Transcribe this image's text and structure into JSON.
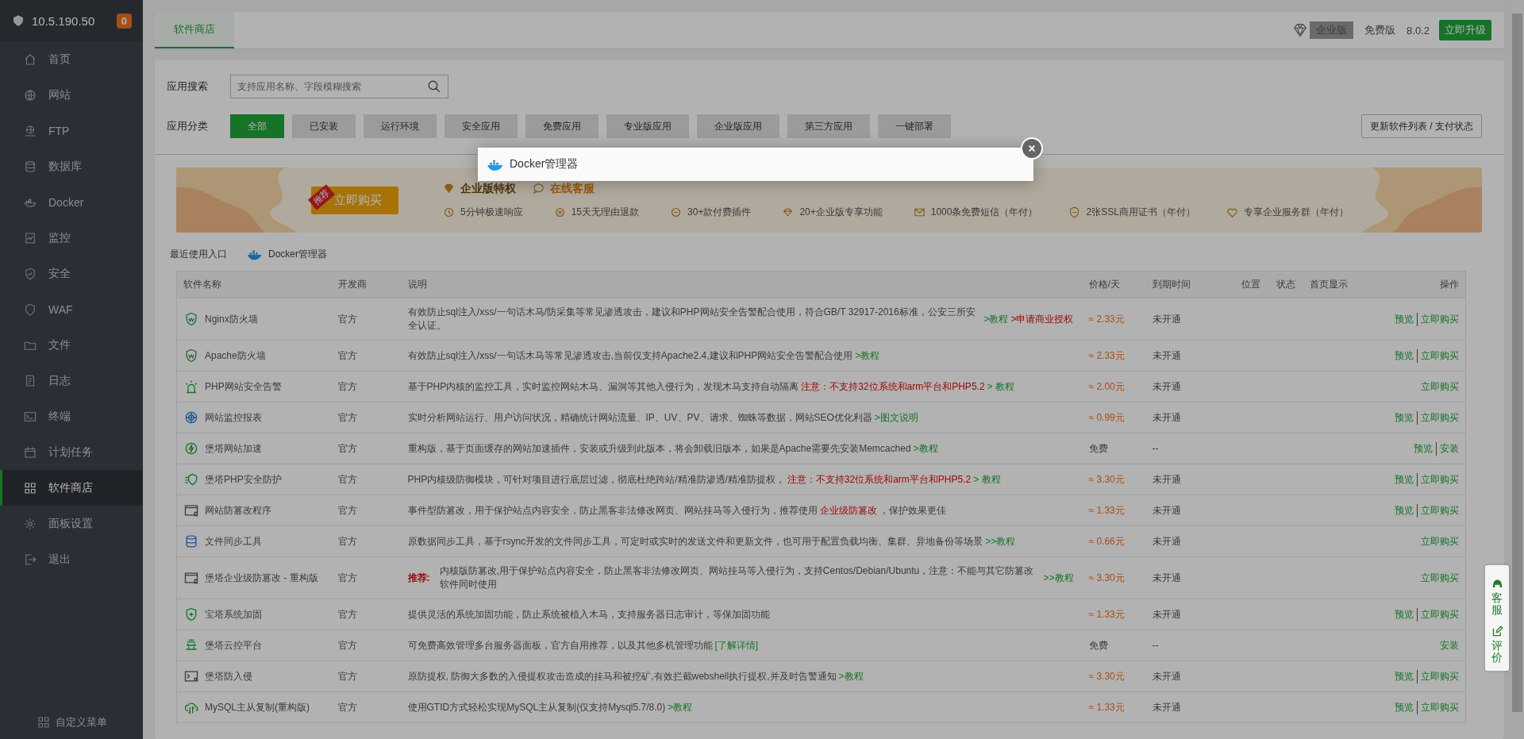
{
  "sidebar": {
    "host": "10.5.190.50",
    "badge": "0",
    "items": [
      {
        "label": "首页",
        "selected": false
      },
      {
        "label": "网站",
        "selected": false
      },
      {
        "label": "FTP",
        "selected": false
      },
      {
        "label": "数据库",
        "selected": false
      },
      {
        "label": "Docker",
        "selected": false
      },
      {
        "label": "监控",
        "selected": false
      },
      {
        "label": "安全",
        "selected": false
      },
      {
        "label": "WAF",
        "selected": false
      },
      {
        "label": "文件",
        "selected": false
      },
      {
        "label": "日志",
        "selected": false
      },
      {
        "label": "终端",
        "selected": false
      },
      {
        "label": "计划任务",
        "selected": false
      },
      {
        "label": "软件商店",
        "selected": true
      },
      {
        "label": "面板设置",
        "selected": false
      },
      {
        "label": "退出",
        "selected": false
      }
    ],
    "footer": "自定义菜单"
  },
  "header": {
    "tabs": [
      {
        "label": "软件商店",
        "selected": true
      }
    ],
    "edition_badge": "企业版",
    "edition": "免费版",
    "version": "8.0.2",
    "upgrade_button": "立即升级"
  },
  "search": {
    "label": "应用搜索",
    "placeholder": "支持应用名称、字段模糊搜索"
  },
  "categories": {
    "label": "应用分类",
    "items": [
      {
        "label": "全部",
        "selected": true
      },
      {
        "label": "已安装",
        "selected": false
      },
      {
        "label": "运行环境",
        "selected": false
      },
      {
        "label": "安全应用",
        "selected": false
      },
      {
        "label": "免费应用",
        "selected": false
      },
      {
        "label": "专业版应用",
        "selected": false
      },
      {
        "label": "企业版应用",
        "selected": false
      },
      {
        "label": "第三方应用",
        "selected": false
      },
      {
        "label": "一键部署",
        "selected": false
      }
    ],
    "refresh_button": "更新软件列表 / 支付状态"
  },
  "banner": {
    "ribbon": "推荐",
    "buy_button": "立即购买",
    "title": "企业版特权",
    "service": "在线客服",
    "benefits": [
      "5分钟极速响应",
      "15天无理由退款",
      "30+款付费插件",
      "20+企业版专享功能",
      "1000条免费短信（年付）",
      "2张SSL商用证书（年付）",
      "专享企业服务群（年付）"
    ]
  },
  "recent": {
    "label": "最近使用入口",
    "items": [
      "Docker管理器"
    ]
  },
  "table": {
    "columns": [
      "软件名称",
      "开发商",
      "说明",
      "价格/天",
      "到期时间",
      "位置",
      "状态",
      "首页显示",
      "操作"
    ],
    "rows": [
      {
        "name": "Nginx防火墙",
        "developer": "官方",
        "description": [
          {
            "kind": "text",
            "text": "有效防止sql注入/xss/一句话木马/防采集等常见渗透攻击，建议和PHP网站安全告警配合使用，符合GB/T 32917-2016标准，公安三所安全认证。"
          },
          {
            "kind": "link",
            "text": ">教程"
          },
          {
            "kind": "warn",
            "text": ">申请商业授权"
          }
        ],
        "price": "≈ 2.33元",
        "paid": true,
        "expiry": "未开通",
        "actions": [
          "预览",
          "立即购买"
        ]
      },
      {
        "name": "Apache防火墙",
        "developer": "官方",
        "description": [
          {
            "kind": "text",
            "text": "有效防止sql注入/xss/一句话木马等常见渗透攻击,当前仅支持Apache2.4,建议和PHP网站安全告警配合使用"
          },
          {
            "kind": "link",
            "text": ">教程"
          }
        ],
        "price": "≈ 2.33元",
        "paid": true,
        "expiry": "未开通",
        "actions": [
          "预览",
          "立即购买"
        ]
      },
      {
        "name": "PHP网站安全告警",
        "developer": "官方",
        "description": [
          {
            "kind": "text",
            "text": "基于PHP内核的监控工具，实时监控网站木马、漏洞等其他入侵行为，发现木马支持自动隔离"
          },
          {
            "kind": "warn",
            "text": "注意：不支持32位系统和arm平台和PHP5.2"
          },
          {
            "kind": "link",
            "text": "> 教程"
          }
        ],
        "price": "≈ 2.00元",
        "paid": true,
        "expiry": "未开通",
        "actions": [
          "立即购买"
        ]
      },
      {
        "name": "网站监控报表",
        "developer": "官方",
        "description": [
          {
            "kind": "text",
            "text": "实时分析网站运行、用户访问状况，精确统计网站流量、IP、UV、PV、请求、蜘蛛等数据，网站SEO优化利器"
          },
          {
            "kind": "link",
            "text": ">图文说明"
          }
        ],
        "price": "≈ 0.99元",
        "paid": true,
        "expiry": "未开通",
        "actions": [
          "预览",
          "立即购买"
        ]
      },
      {
        "name": "堡塔网站加速",
        "developer": "官方",
        "description": [
          {
            "kind": "text",
            "text": "重构版，基于页面缓存的网站加速插件，安装或升级到此版本，将会卸载旧版本，如果是Apache需要先安装Memcached"
          },
          {
            "kind": "link",
            "text": ">教程"
          }
        ],
        "price": "免费",
        "paid": false,
        "expiry": "--",
        "actions": [
          "预览",
          "安装"
        ]
      },
      {
        "name": "堡塔PHP安全防护",
        "developer": "官方",
        "description": [
          {
            "kind": "text",
            "text": "PHP内核级防御模块，可针对项目进行底层过滤，彻底杜绝跨站/精准防渗透/精准防提权，"
          },
          {
            "kind": "warn",
            "text": "注意：不支持32位系统和arm平台和PHP5.2"
          },
          {
            "kind": "link",
            "text": "> 教程"
          }
        ],
        "price": "≈ 3.30元",
        "paid": true,
        "expiry": "未开通",
        "actions": [
          "预览",
          "立即购买"
        ]
      },
      {
        "name": "网站防篡改程序",
        "developer": "官方",
        "description": [
          {
            "kind": "text",
            "text": "事件型防篡改，用于保护站点内容安全，防止黑客非法修改网页、网站挂马等入侵行为，推荐使用"
          },
          {
            "kind": "warn",
            "text": "企业级防篡改"
          },
          {
            "kind": "text",
            "text": "，保护效果更佳"
          }
        ],
        "price": "≈ 1.33元",
        "paid": true,
        "expiry": "未开通",
        "actions": [
          "预览",
          "立即购买"
        ]
      },
      {
        "name": "文件同步工具",
        "developer": "官方",
        "description": [
          {
            "kind": "text",
            "text": "原数据同步工具，基于rsync开发的文件同步工具，可定时或实时的发送文件和更新文件，也可用于配置负载均衡、集群、异地备份等场景"
          },
          {
            "kind": "link",
            "text": ">>教程"
          }
        ],
        "price": "≈ 0.66元",
        "paid": true,
        "expiry": "未开通",
        "actions": [
          "立即购买"
        ]
      },
      {
        "name": "堡塔企业级防篡改 - 重构版",
        "developer": "官方",
        "description": [
          {
            "kind": "tag",
            "text": "推荐:"
          },
          {
            "kind": "text",
            "text": "内核版防篡改,用于保护站点内容安全，防止黑客非法修改网页、网站挂马等入侵行为，支持Centos/Debian/Ubuntu，注意：不能与其它防篡改软件同时使用"
          },
          {
            "kind": "link",
            "text": ">>教程"
          }
        ],
        "price": "≈ 3.30元",
        "paid": true,
        "expiry": "未开通",
        "actions": [
          "立即购买"
        ]
      },
      {
        "name": "宝塔系统加固",
        "developer": "官方",
        "description": [
          {
            "kind": "text",
            "text": "提供灵活的系统加固功能，防止系统被植入木马，支持服务器日志审计，等保加固功能"
          }
        ],
        "price": "≈ 1.33元",
        "paid": true,
        "expiry": "未开通",
        "actions": [
          "预览",
          "立即购买"
        ]
      },
      {
        "name": "堡塔云控平台",
        "developer": "官方",
        "description": [
          {
            "kind": "text",
            "text": "可免费高效管理多台服务器面板，官方自用推荐，以及其他多机管理功能"
          },
          {
            "kind": "link",
            "text": "[了解详情]"
          }
        ],
        "price": "免费",
        "paid": false,
        "expiry": "--",
        "actions": [
          "安装"
        ]
      },
      {
        "name": "堡塔防入侵",
        "developer": "官方",
        "description": [
          {
            "kind": "text",
            "text": "原防提权, 防御大多数的入侵提权攻击造成的挂马和被挖矿,有效拦截webshell执行提权,并及时告警通知"
          },
          {
            "kind": "link",
            "text": ">教程"
          }
        ],
        "price": "≈ 3.30元",
        "paid": true,
        "expiry": "未开通",
        "actions": [
          "预览",
          "立即购买"
        ]
      },
      {
        "name": "MySQL主从复制(重构版)",
        "developer": "官方",
        "description": [
          {
            "kind": "text",
            "text": "使用GTID方式轻松实现MySQL主从复制(仅支持Mysql5.7/8.0)"
          },
          {
            "kind": "link",
            "text": ">教程"
          }
        ],
        "price": "≈ 1.33元",
        "paid": true,
        "expiry": "未开通",
        "actions": [
          "预览",
          "立即购买"
        ]
      }
    ]
  },
  "side_widget": [
    "客服",
    "评价"
  ],
  "dialog": {
    "title": "Docker管理器"
  }
}
